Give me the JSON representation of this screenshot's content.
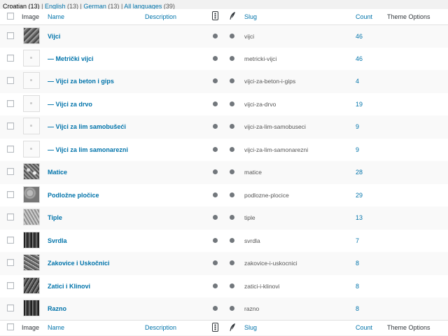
{
  "languages": {
    "current": "Croatian",
    "current_count": "(13)",
    "sep": "|",
    "links": [
      {
        "label": "English",
        "count": "(13)"
      },
      {
        "label": "German",
        "count": "(13)"
      },
      {
        "label": "All languages",
        "count": "(39)"
      }
    ]
  },
  "columns": {
    "image": "Image",
    "name": "Name",
    "description": "Description",
    "slug": "Slug",
    "count": "Count",
    "theme_options": "Theme Options"
  },
  "icons": {
    "column_a": "translation-status-icon",
    "column_b": "feather-icon",
    "status_dot": "status-dot"
  },
  "colors": {
    "link": "#0073aa",
    "dot": "#72777c",
    "row_alt": "#f9f9f9"
  },
  "rows": [
    {
      "name": "Vijci",
      "slug": "vijci",
      "count": "46",
      "thumb": "tx1"
    },
    {
      "name": "— Metrički vijci",
      "slug": "metricki-vijci",
      "count": "46",
      "thumb": "ph"
    },
    {
      "name": "— Vijci za beton i gips",
      "slug": "vijci-za-beton-i-gips",
      "count": "4",
      "thumb": "ph"
    },
    {
      "name": "— Vijci za drvo",
      "slug": "vijci-za-drvo",
      "count": "19",
      "thumb": "ph"
    },
    {
      "name": "— Vijci za lim samobušeći",
      "slug": "vijci-za-lim-samobuseci",
      "count": "9",
      "thumb": "ph"
    },
    {
      "name": "— Vijci za lim samonarezni",
      "slug": "vijci-za-lim-samonarezni",
      "count": "9",
      "thumb": "ph"
    },
    {
      "name": "Matice",
      "slug": "matice",
      "count": "28",
      "thumb": "tx2"
    },
    {
      "name": "Podložne pločice",
      "slug": "podlozne-plocice",
      "count": "29",
      "thumb": "tx3"
    },
    {
      "name": "Tiple",
      "slug": "tiple",
      "count": "13",
      "thumb": "tx4"
    },
    {
      "name": "Svrdla",
      "slug": "svrdla",
      "count": "7",
      "thumb": "tx5"
    },
    {
      "name": "Zakovice i Uskočnici",
      "slug": "zakovice-i-uskocnici",
      "count": "8",
      "thumb": "tx6"
    },
    {
      "name": "Zatici i Klinovi",
      "slug": "zatici-i-klinovi",
      "count": "8",
      "thumb": "tx7"
    },
    {
      "name": "Razno",
      "slug": "razno",
      "count": "8",
      "thumb": "tx5"
    }
  ]
}
